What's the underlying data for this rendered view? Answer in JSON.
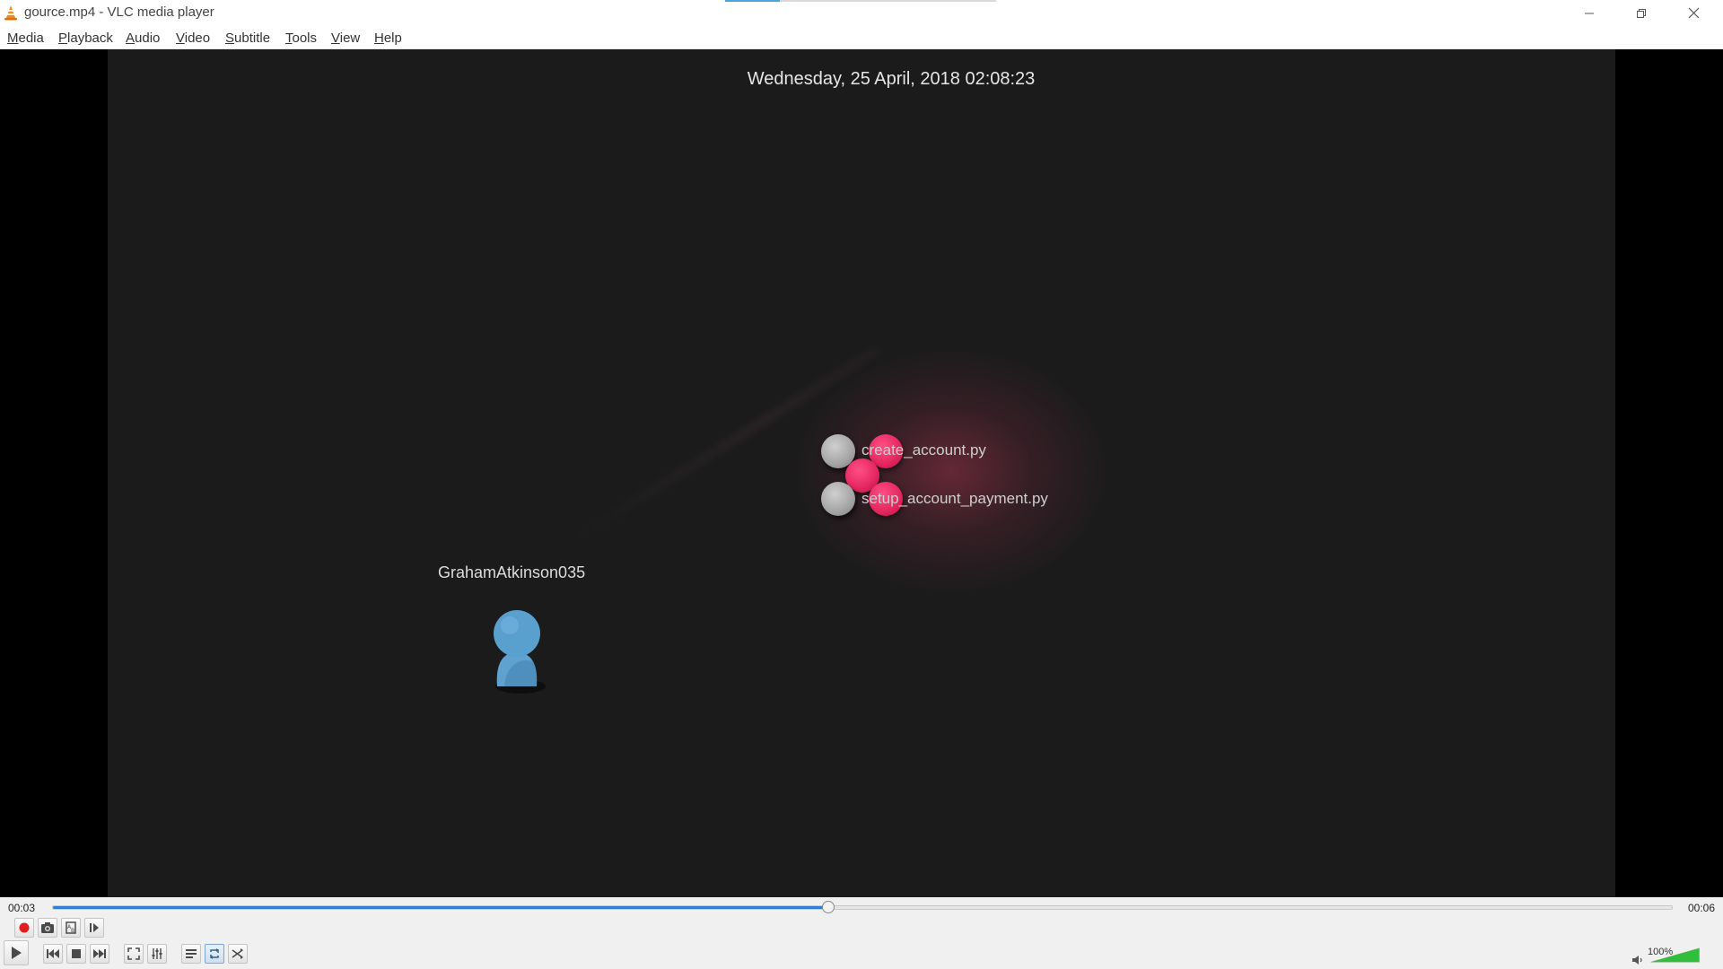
{
  "window": {
    "title": "gource.mp4 - VLC media player",
    "icon": "vlc-cone-icon"
  },
  "menubar": {
    "items": [
      {
        "first": "M",
        "rest": "edia"
      },
      {
        "first": "P",
        "rest": "layback"
      },
      {
        "first": "A",
        "rest": "udio"
      },
      {
        "first": "V",
        "rest": "ideo"
      },
      {
        "first": "S",
        "rest": "ubtitle"
      },
      {
        "first": "T",
        "rest": "ools"
      },
      {
        "first": "V",
        "rest": "iew"
      },
      {
        "first": "H",
        "rest": "elp"
      }
    ]
  },
  "video": {
    "timestamp": "Wednesday, 25 April, 2018 02:08:23",
    "files": [
      "create_account.py",
      "setup_account_payment.py"
    ],
    "user": "GrahamAtkinson035"
  },
  "playback": {
    "elapsed": "00:03",
    "total": "00:06",
    "progress_fraction": 0.479
  },
  "volume": {
    "level": "100%",
    "level_fraction": 1.0
  },
  "colors": {
    "seek_fill": "#2f7fd6",
    "volume_fill": "#2fbf3a",
    "record": "#e02020",
    "node_pink": "#e4265e",
    "avatar": "#5aa0cf"
  }
}
